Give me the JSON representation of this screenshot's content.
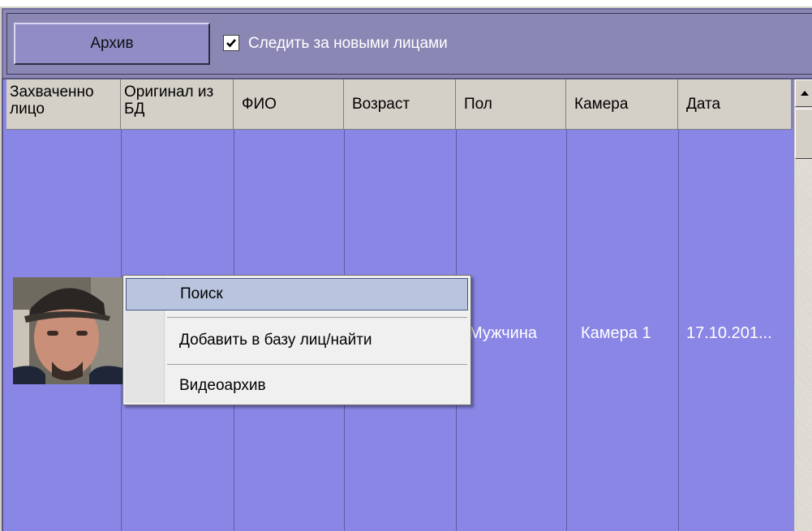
{
  "toolbar": {
    "archive_button": "Архив",
    "follow_checkbox": {
      "label": "Следить за новыми лицами",
      "checked": true
    }
  },
  "grid": {
    "columns": [
      "Захваченно лицо",
      "Оригинал из БД",
      "ФИО",
      "Возраст",
      "Пол",
      "Камера",
      "Дата"
    ],
    "rows": [
      {
        "captured_face": "face-photo",
        "db_original": "",
        "name": "",
        "age": "",
        "gender": "Мужчина",
        "camera": "Камера 1",
        "date": "17.10.201..."
      }
    ],
    "row_color": "#8a86e6"
  },
  "context_menu": {
    "items": [
      {
        "label": "Поиск",
        "highlighted": true
      },
      {
        "label": "Добавить в базу лиц/найти",
        "highlighted": false
      },
      {
        "label": "Видеоархив",
        "highlighted": false
      }
    ]
  },
  "colors": {
    "toolbar_bg": "#8b87b5",
    "row_bg": "#8a86e6",
    "header_bg": "#d4d0c8",
    "menu_highlight": "#b9c4de"
  }
}
